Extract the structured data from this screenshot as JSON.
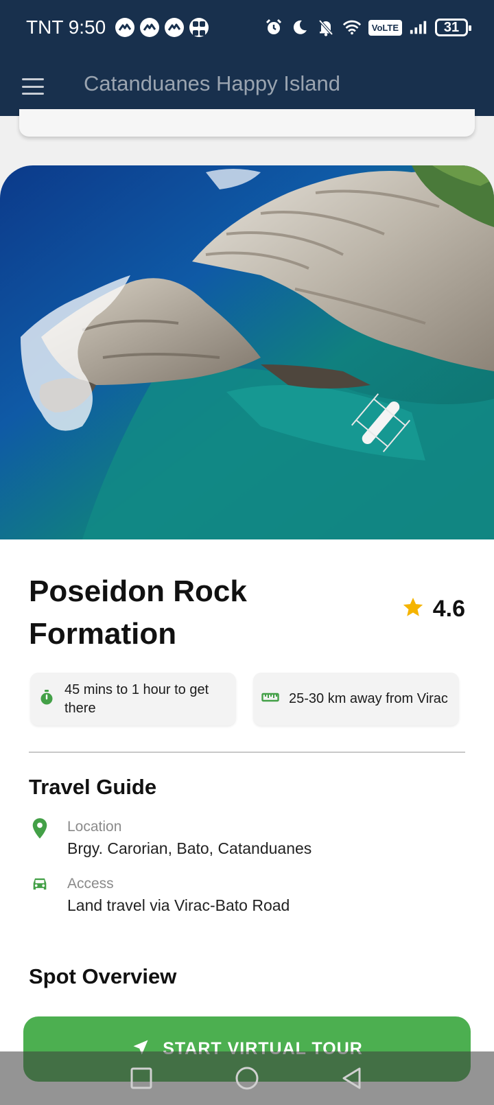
{
  "status_bar": {
    "carrier": "TNT",
    "time": "9:50",
    "volte": "VoLTE",
    "battery": "31"
  },
  "app_bar": {
    "title": "Catanduanes Happy Island"
  },
  "place": {
    "name": "Poseidon Rock Formation",
    "rating": "4.6",
    "travel_time": "45 mins to 1 hour to get there",
    "distance": "25-30 km away from Virac"
  },
  "travel_guide": {
    "title": "Travel Guide",
    "location_label": "Location",
    "location_value": "Brgy. Carorian, Bato, Catanduanes",
    "access_label": "Access",
    "access_value": "Land travel via Virac-Bato Road"
  },
  "spot_overview": {
    "title": "Spot Overview"
  },
  "actions": {
    "start_tour": "START VIRTUAL TOUR"
  },
  "colors": {
    "header": "#18304d",
    "accent_green": "#4caf50",
    "star": "#f5b400"
  },
  "icons": {
    "menu": "menu-icon",
    "timer": "timer-icon",
    "ruler": "ruler-icon",
    "location": "location-pin-icon",
    "car": "car-icon",
    "navigate": "navigation-arrow-icon"
  }
}
